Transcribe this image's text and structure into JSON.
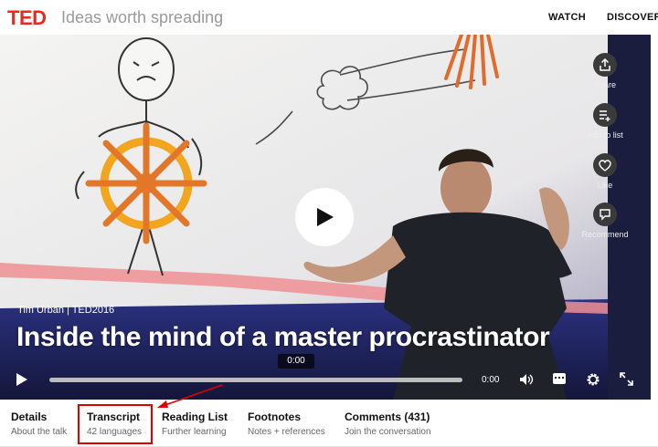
{
  "header": {
    "logo": "TED",
    "tagline": "Ideas worth spreading",
    "nav": [
      {
        "label": "WATCH"
      },
      {
        "label": "DISCOVER"
      }
    ]
  },
  "video": {
    "speaker_line": "Tim Urban | TED2016",
    "title": "Inside the mind of a master procrastinator",
    "hover_time": "0:00",
    "current_time": "0:00",
    "progress_fraction": 0,
    "side_actions": [
      {
        "label": "Share",
        "icon": "share-icon"
      },
      {
        "label": "Add to list",
        "icon": "add-to-list-icon"
      },
      {
        "label": "Like",
        "icon": "heart-icon"
      },
      {
        "label": "Recommend",
        "icon": "recommend-icon"
      }
    ]
  },
  "tabs": [
    {
      "title": "Details",
      "subtitle": "About the talk"
    },
    {
      "title": "Transcript",
      "subtitle": "42 languages"
    },
    {
      "title": "Reading List",
      "subtitle": "Further learning"
    },
    {
      "title": "Footnotes",
      "subtitle": "Notes + references"
    },
    {
      "title": "Comments (431)",
      "subtitle": "Join the conversation"
    }
  ],
  "colors": {
    "brand_red": "#e62b1e",
    "highlight_red": "#e00000"
  }
}
